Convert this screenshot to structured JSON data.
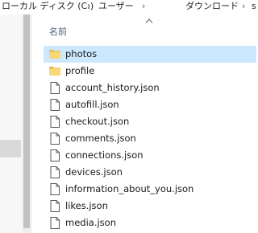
{
  "address_bar": {
    "segments": [
      "ローカル ディスク (C:)",
      "ユーザー",
      "ダウンロード",
      "s"
    ]
  },
  "column_header": {
    "name_label": "名前"
  },
  "files": [
    {
      "name": "photos",
      "type": "folder",
      "selected": true
    },
    {
      "name": "profile",
      "type": "folder",
      "selected": false
    },
    {
      "name": "account_history.json",
      "type": "file",
      "selected": false
    },
    {
      "name": "autofill.json",
      "type": "file",
      "selected": false
    },
    {
      "name": "checkout.json",
      "type": "file",
      "selected": false
    },
    {
      "name": "comments.json",
      "type": "file",
      "selected": false
    },
    {
      "name": "connections.json",
      "type": "file",
      "selected": false
    },
    {
      "name": "devices.json",
      "type": "file",
      "selected": false
    },
    {
      "name": "information_about_you.json",
      "type": "file",
      "selected": false
    },
    {
      "name": "likes.json",
      "type": "file",
      "selected": false
    },
    {
      "name": "media.json",
      "type": "file",
      "selected": false
    }
  ],
  "colors": {
    "selection": "#cce8ff",
    "folder": "#f8d775",
    "header_text": "#4c607a"
  }
}
